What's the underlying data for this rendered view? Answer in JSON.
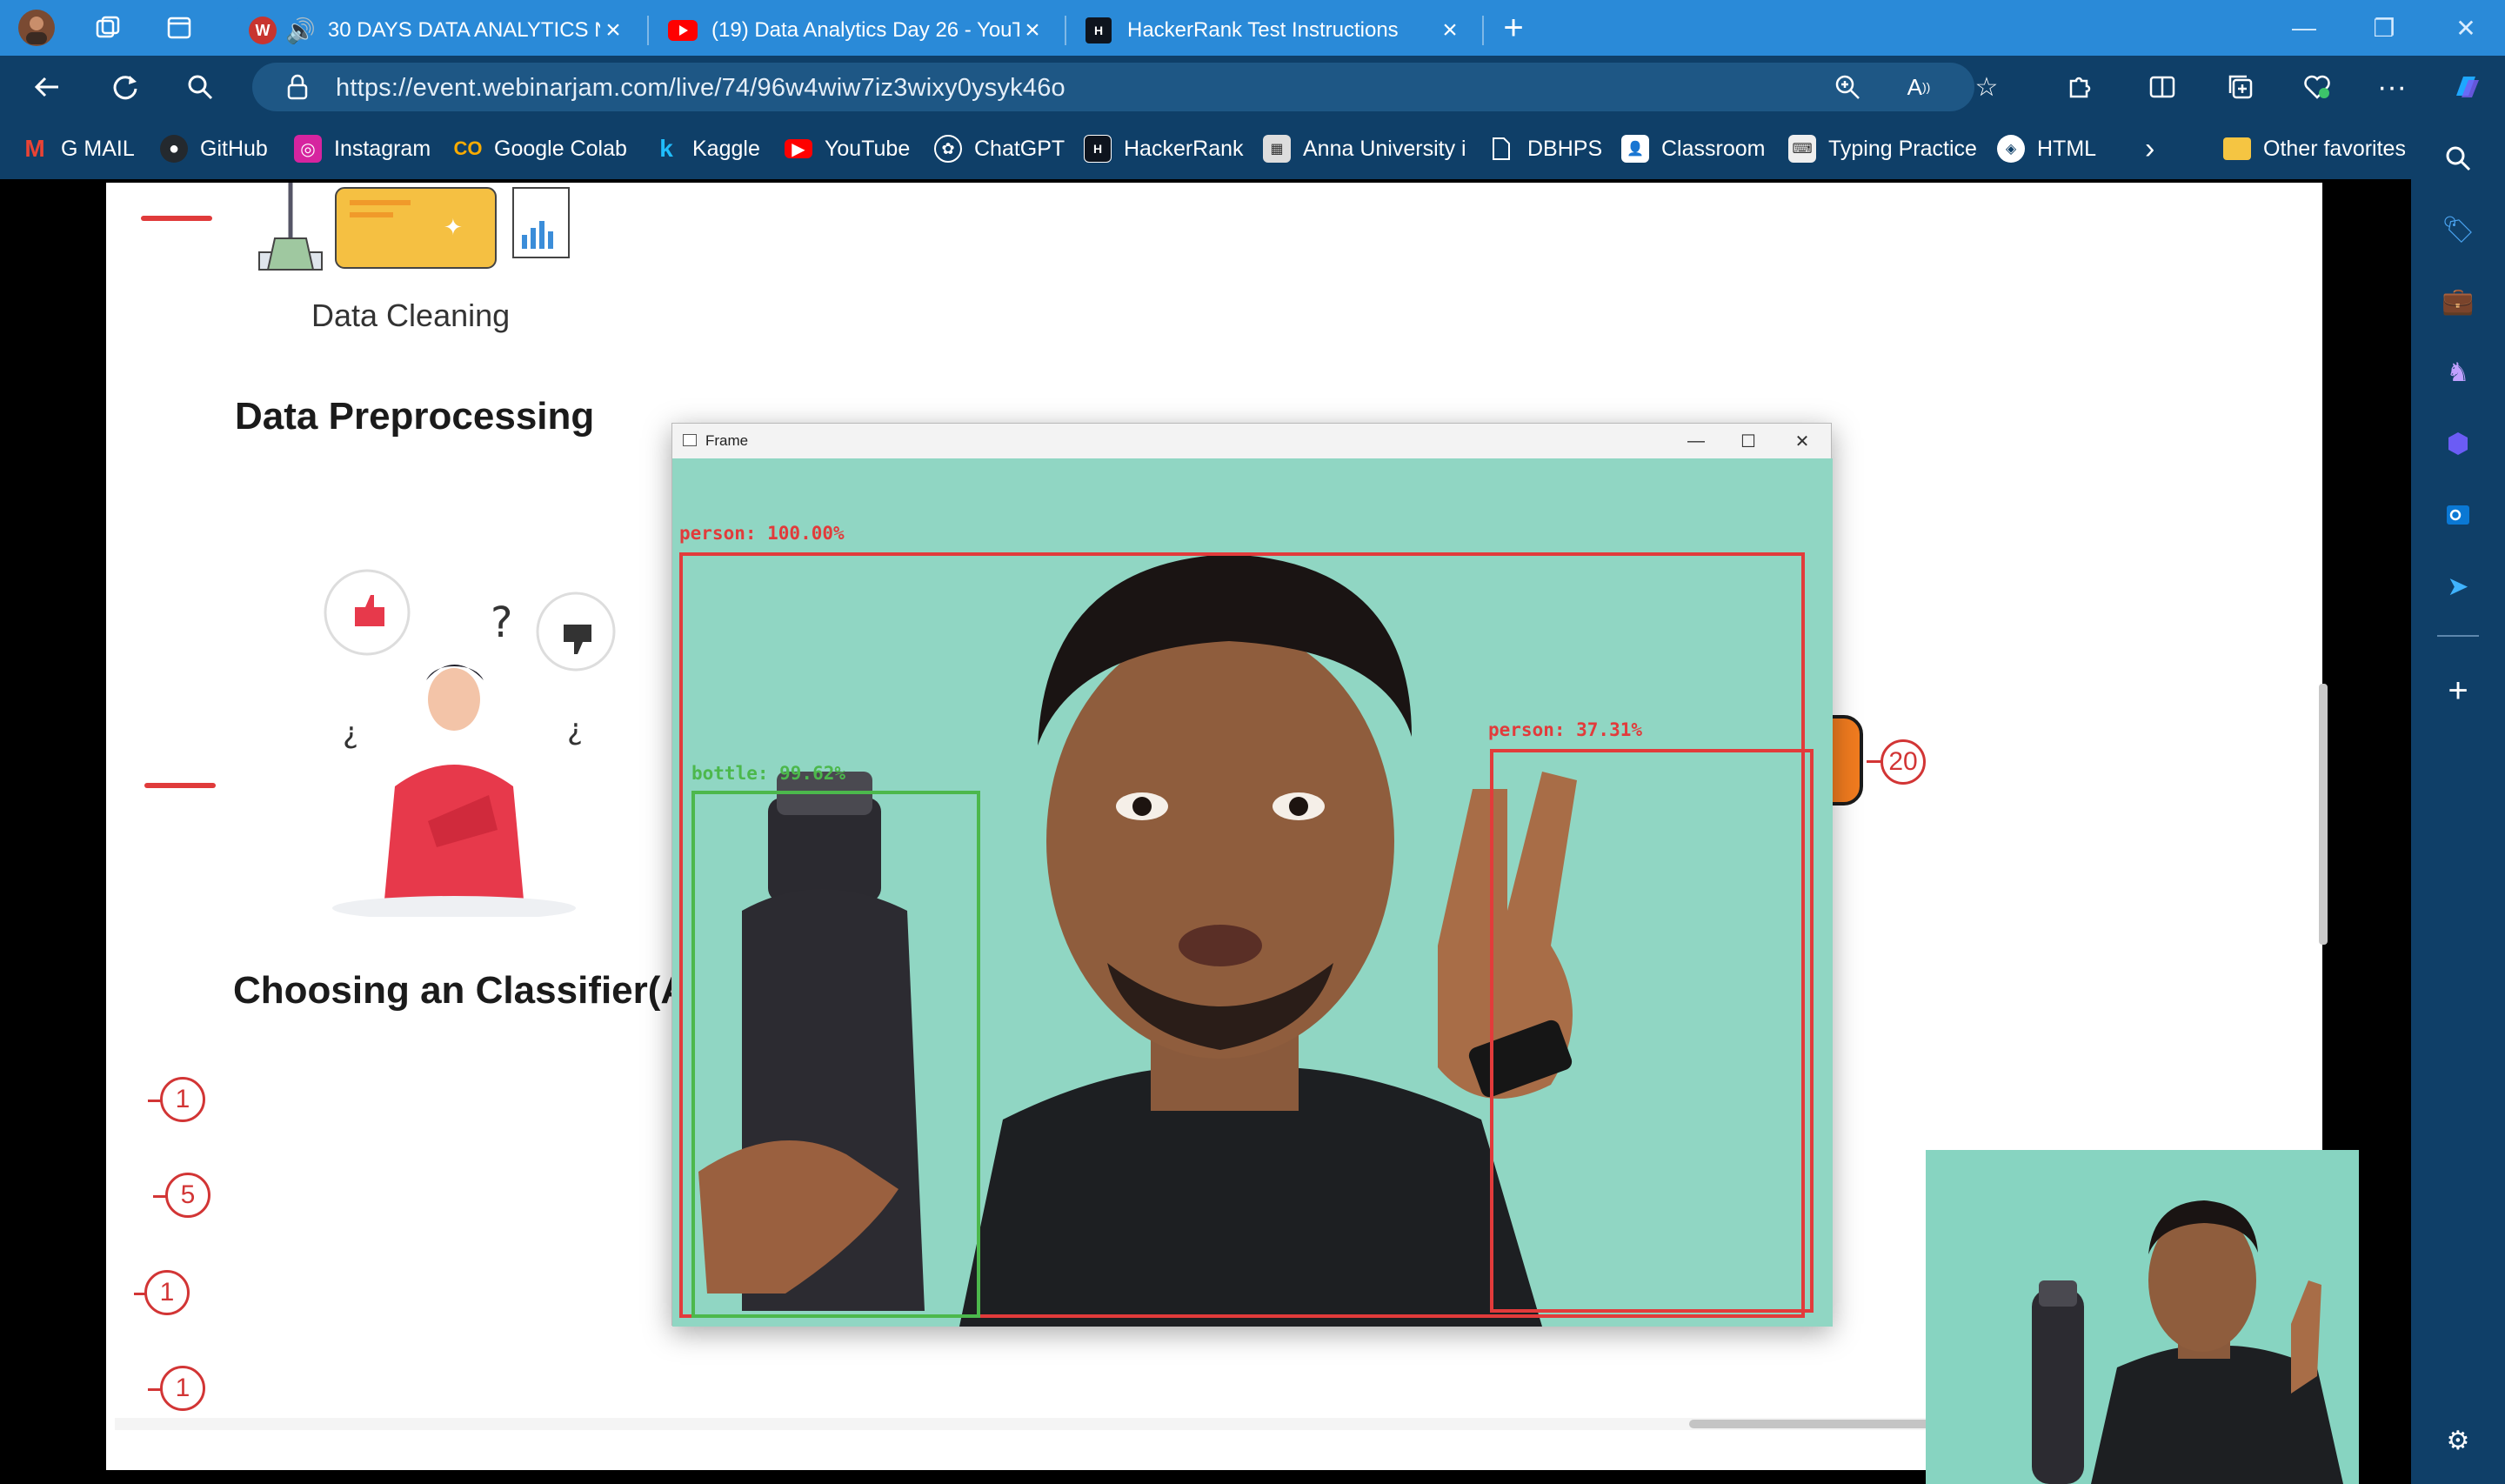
{
  "browser": {
    "tabs": [
      {
        "title": "30 DAYS DATA ANALYTICS N",
        "icon": "webinarjam-icon",
        "audio": true,
        "active": true
      },
      {
        "title": "(19) Data Analytics Day 26 - YouT",
        "icon": "youtube-icon",
        "active": false
      },
      {
        "title": "HackerRank Test Instructions",
        "icon": "hackerrank-icon",
        "active": false
      }
    ],
    "url": "https://event.webinarjam.com/live/74/96w4wiw7iz3wixy0ysyk46o",
    "favorites": [
      {
        "label": "G MAIL",
        "icon": "gmail-icon",
        "color": "#ea4335"
      },
      {
        "label": "GitHub",
        "icon": "github-icon",
        "color": "#24292e"
      },
      {
        "label": "Instagram",
        "icon": "instagram-icon",
        "color": "#d6249f"
      },
      {
        "label": "Google Colab",
        "icon": "colab-icon",
        "color": "#f9ab00"
      },
      {
        "label": "Kaggle",
        "icon": "kaggle-icon",
        "color": "#20beff"
      },
      {
        "label": "YouTube",
        "icon": "youtube-icon",
        "color": "#ff0000"
      },
      {
        "label": "ChatGPT",
        "icon": "chatgpt-icon",
        "color": "#ffffff"
      },
      {
        "label": "HackerRank",
        "icon": "hackerrank-icon",
        "color": "#1ba94c"
      },
      {
        "label": "Anna University i",
        "icon": "anna-university-icon",
        "color": "#cccccc"
      },
      {
        "label": "DBHPS",
        "icon": "page-icon",
        "color": "#ffffff"
      },
      {
        "label": "Classroom",
        "icon": "classroom-icon",
        "color": "#ffffff"
      },
      {
        "label": "Typing Practice",
        "icon": "typing-icon",
        "color": "#ffffff"
      },
      {
        "label": "HTML",
        "icon": "html-icon",
        "color": "#ffffff"
      }
    ],
    "other_favorites": "Other favorites"
  },
  "whiteboard": {
    "caption_cleaning": "Data Cleaning",
    "heading_preprocessing": "Data Preprocessing",
    "heading_classifier": "Choosing an Classifier(Al",
    "badge_number": "20",
    "list_numbers": [
      "1",
      "5",
      "1",
      "1"
    ]
  },
  "frame_window": {
    "title": "Frame",
    "detections": [
      {
        "label": "person: 100.00%",
        "color": "#e23b3b"
      },
      {
        "label": "person: 37.31%",
        "color": "#e23b3b"
      },
      {
        "label": "bottle: 99.62%",
        "color": "#4cb84c"
      }
    ]
  }
}
